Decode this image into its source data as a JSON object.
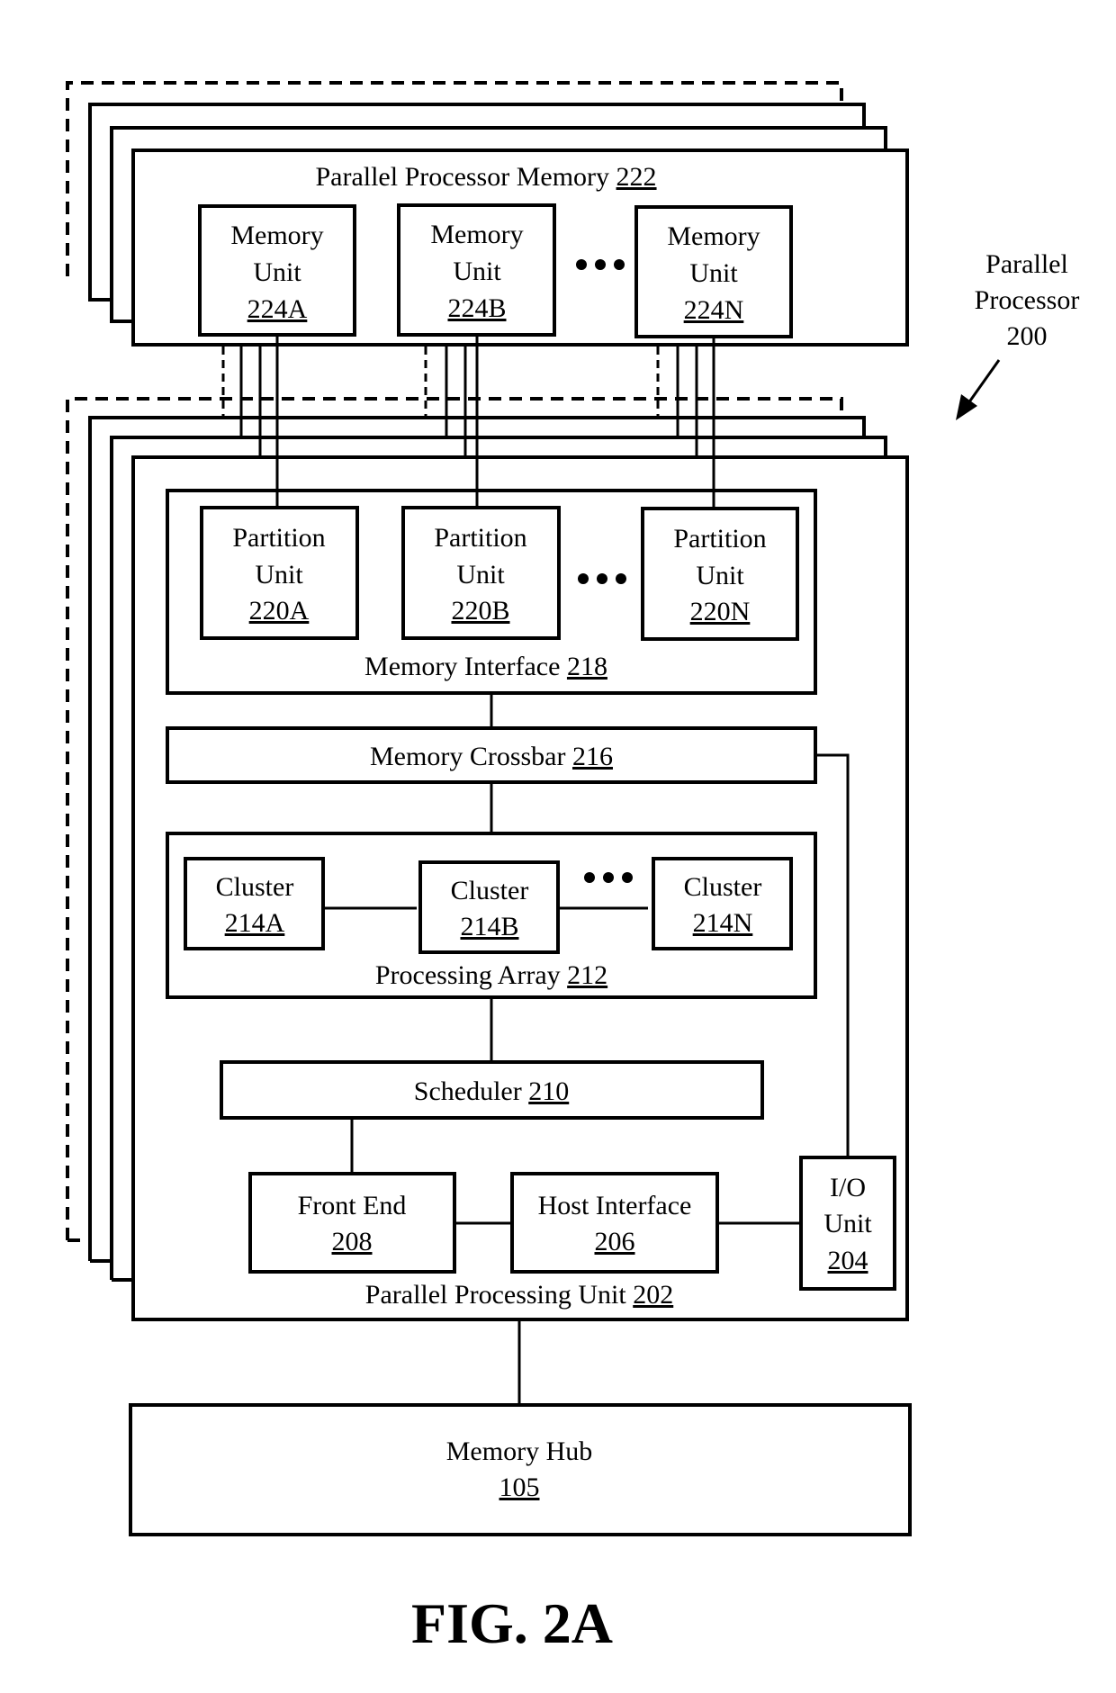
{
  "figure": {
    "caption": "FIG. 2A",
    "system_label": {
      "line1": "Parallel",
      "line2": "Processor",
      "ref": "200"
    }
  },
  "parallel_processor_memory": {
    "title": "Parallel Processor Memory",
    "ref": "222",
    "units": [
      {
        "line1": "Memory",
        "line2": "Unit",
        "ref": "224A"
      },
      {
        "line1": "Memory",
        "line2": "Unit",
        "ref": "224B"
      },
      {
        "line1": "Memory",
        "line2": "Unit",
        "ref": "224N"
      }
    ],
    "ellipsis": "•••"
  },
  "parallel_processing_unit": {
    "title": "Parallel Processing Unit",
    "ref": "202",
    "memory_interface": {
      "title": "Memory Interface",
      "ref": "218",
      "partition_units": [
        {
          "line1": "Partition",
          "line2": "Unit",
          "ref": "220A"
        },
        {
          "line1": "Partition",
          "line2": "Unit",
          "ref": "220B"
        },
        {
          "line1": "Partition",
          "line2": "Unit",
          "ref": "220N"
        }
      ]
    },
    "memory_crossbar": {
      "title": "Memory Crossbar",
      "ref": "216"
    },
    "processing_array": {
      "title": "Processing Array",
      "ref": "212",
      "clusters": [
        {
          "label": "Cluster",
          "ref": "214A"
        },
        {
          "label": "Cluster",
          "ref": "214B"
        },
        {
          "label": "Cluster",
          "ref": "214N"
        }
      ]
    },
    "scheduler": {
      "title": "Scheduler",
      "ref": "210"
    },
    "front_end": {
      "title": "Front End",
      "ref": "208"
    },
    "host_interface": {
      "title": "Host Interface",
      "ref": "206"
    },
    "io_unit": {
      "line1": "I/O",
      "line2": "Unit",
      "ref": "204"
    }
  },
  "memory_hub": {
    "title": "Memory Hub",
    "ref": "105"
  }
}
